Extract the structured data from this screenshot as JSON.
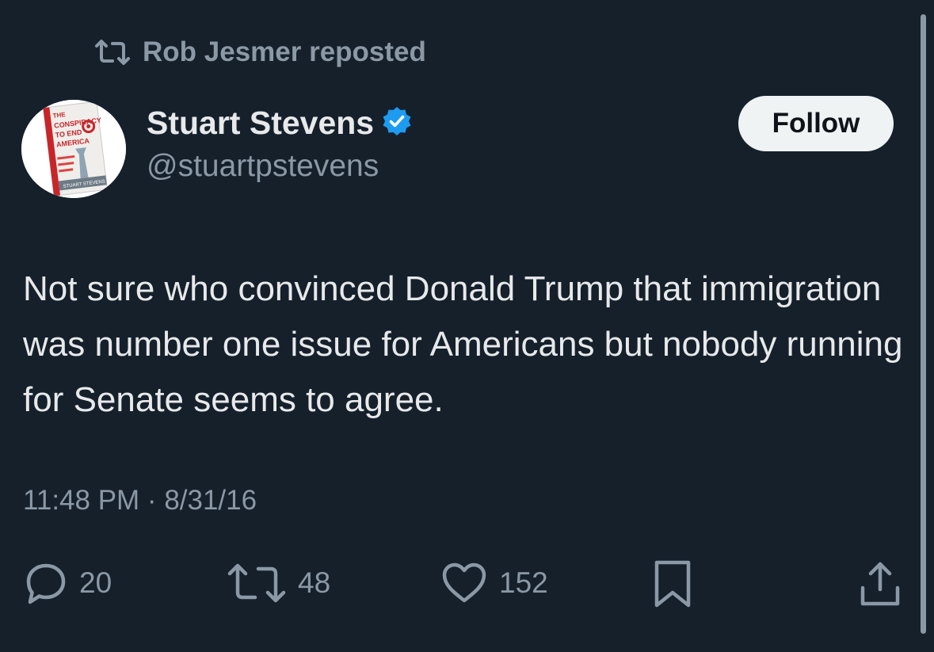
{
  "repost": {
    "icon": "repost-icon",
    "text": "Rob Jesmer reposted"
  },
  "author": {
    "display_name": "Stuart Stevens",
    "handle": "@stuartpstevens",
    "verified_icon": "verified-badge-icon",
    "avatar_book": {
      "line1": "THE",
      "line2": "CONSPIRACY",
      "line3": "TO END",
      "line4": "AMERICA",
      "author": "STUART STEVENS"
    }
  },
  "follow_button": {
    "label": "Follow"
  },
  "tweet": {
    "text": "Not sure who convinced Donald Trump that immigration was number one issue for Americans but nobody running for Senate seems to agree.",
    "timestamp": "11:48 PM · 8/31/16"
  },
  "actions": {
    "replies": {
      "icon": "reply-icon",
      "count": "20"
    },
    "reposts": {
      "icon": "repost-icon",
      "count": "48"
    },
    "likes": {
      "icon": "like-icon",
      "count": "152"
    },
    "bookmark": {
      "icon": "bookmark-icon"
    },
    "share": {
      "icon": "share-icon"
    }
  },
  "colors": {
    "background": "#15202b",
    "primary_text": "#e7e9ea",
    "secondary_text": "#8b98a5",
    "verified": "#1d9bf0",
    "follow_bg": "#eff3f4"
  }
}
